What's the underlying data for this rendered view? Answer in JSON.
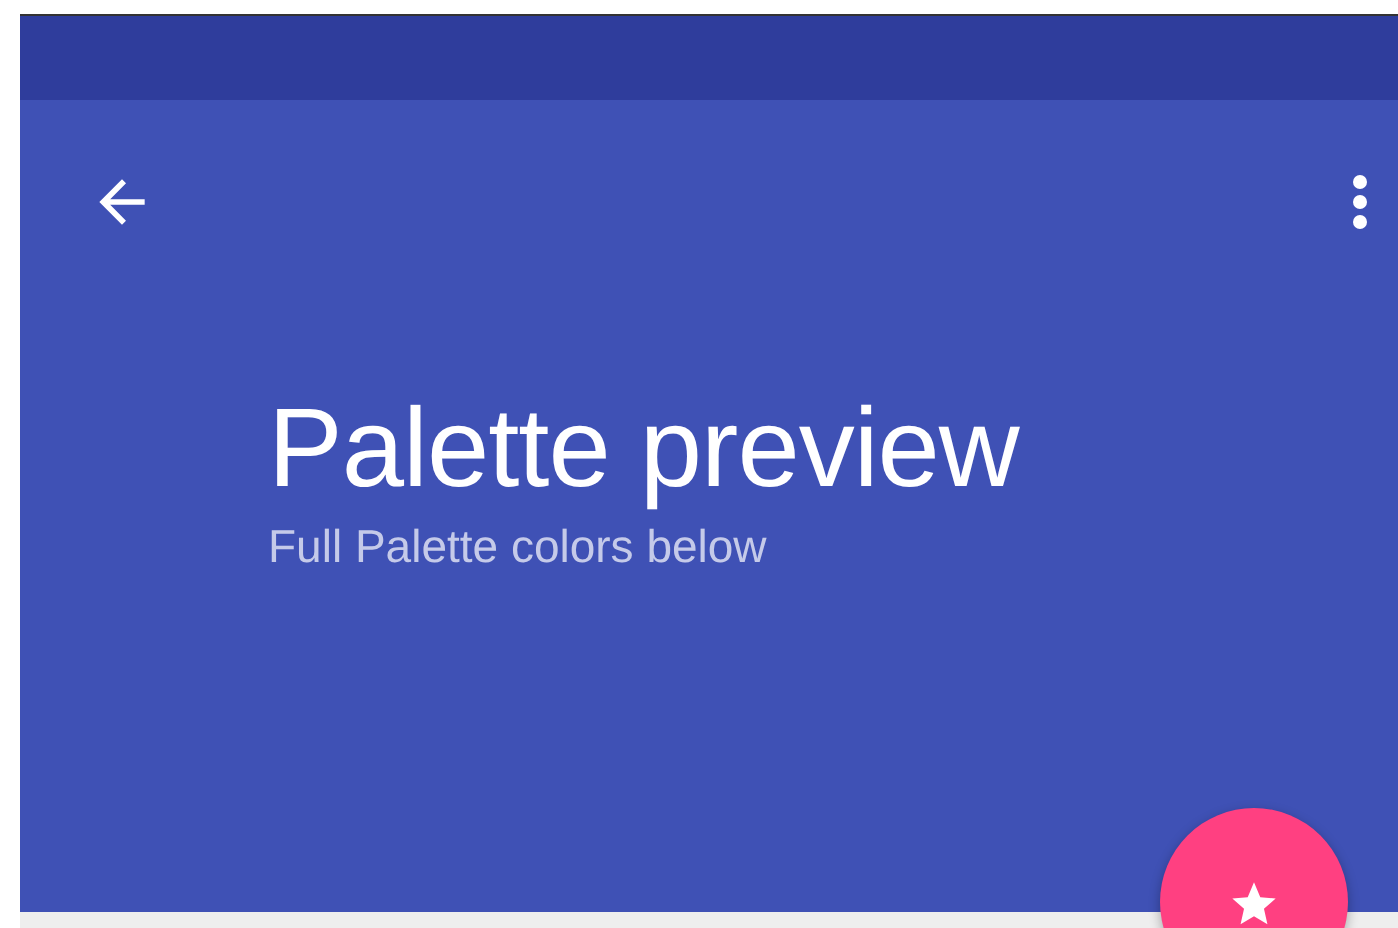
{
  "header": {
    "title": "Palette preview",
    "subtitle": "Full Palette colors below"
  }
}
